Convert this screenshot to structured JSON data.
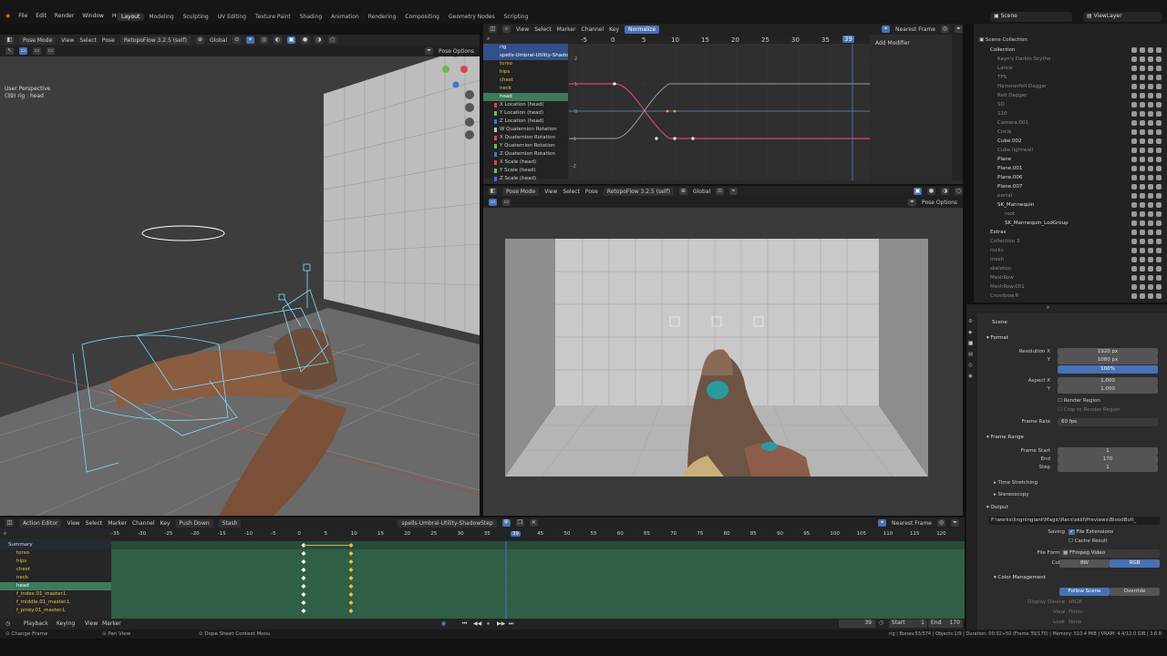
{
  "topbar": {
    "menus": [
      "File",
      "Edit",
      "Render",
      "Window",
      "Help"
    ],
    "workspaces": [
      "Layout",
      "Modeling",
      "Sculpting",
      "UV Editing",
      "Texture Paint",
      "Shading",
      "Animation",
      "Rendering",
      "Compositing",
      "Geometry Nodes",
      "Scripting"
    ],
    "active_workspace": "Layout",
    "scene": "Scene",
    "view_layer": "ViewLayer"
  },
  "viewport": {
    "mode": "Pose Mode",
    "menus": [
      "View",
      "Select",
      "Pose"
    ],
    "action": "RetopoFlow 3.2.5 (self)",
    "orientation": "Global",
    "pose_options": "Pose Options",
    "info_line1": "User Perspective",
    "info_line2": "(39) rig : head"
  },
  "graph": {
    "menus": [
      "View",
      "Select",
      "Marker",
      "Channel",
      "Key"
    ],
    "normalize": "Normalize",
    "snap": "Nearest Frame",
    "add_modifier": "Add Modifier",
    "ticks": [
      "-5",
      "0",
      "5",
      "10",
      "15",
      "20",
      "25",
      "30",
      "35",
      "39"
    ],
    "yticks": [
      "2",
      "1",
      "0",
      "-1",
      "-2"
    ],
    "channels": [
      {
        "label": "rig",
        "cls": "blue"
      },
      {
        "label": "spells-Umbral-Utility-ShadowStep",
        "cls": "blue"
      },
      {
        "label": "torso",
        "cls": "bone"
      },
      {
        "label": "hips",
        "cls": "bone"
      },
      {
        "label": "chest",
        "cls": "bone"
      },
      {
        "label": "neck",
        "cls": "bone"
      },
      {
        "label": "head",
        "cls": "sel"
      },
      {
        "label": "X Location (head)",
        "cls": "",
        "color": "#e04050"
      },
      {
        "label": "Y Location (head)",
        "cls": "",
        "color": "#60c060"
      },
      {
        "label": "Z Location (head)",
        "cls": "",
        "color": "#4070e0"
      },
      {
        "label": "W Quaternion Rotation",
        "cls": "",
        "color": "#c0c0c0"
      },
      {
        "label": "X Quaternion Rotation",
        "cls": "",
        "color": "#e04050"
      },
      {
        "label": "Y Quaternion Rotation",
        "cls": "",
        "color": "#60c060"
      },
      {
        "label": "Z Quaternion Rotation",
        "cls": "",
        "color": "#4070e0"
      },
      {
        "label": "X Scale (head)",
        "cls": "",
        "color": "#e04050"
      },
      {
        "label": "Y Scale (head)",
        "cls": "",
        "color": "#60c060"
      },
      {
        "label": "Z Scale (head)",
        "cls": "",
        "color": "#4070e0"
      }
    ]
  },
  "camview": {
    "mode": "Pose Mode",
    "menus": [
      "View",
      "Select",
      "Pose"
    ],
    "action": "RetopoFlow 3.2.5 (self)",
    "orientation": "Global",
    "pose_options": "Pose Options"
  },
  "outliner": {
    "title": "Scene Collection",
    "items": [
      {
        "label": "Collection",
        "indent": 1,
        "color": "#ddd"
      },
      {
        "label": "Kayn's Darkin Scythe",
        "indent": 2,
        "color": "#888"
      },
      {
        "label": "Lance",
        "indent": 2,
        "color": "#888"
      },
      {
        "label": "TPS",
        "indent": 2,
        "color": "#888"
      },
      {
        "label": "Hammerfell Dagger",
        "indent": 2,
        "color": "#888"
      },
      {
        "label": "Red Dagger",
        "indent": 2,
        "color": "#888"
      },
      {
        "label": "SD",
        "indent": 2,
        "color": "#888"
      },
      {
        "label": "110",
        "indent": 2,
        "color": "#888"
      },
      {
        "label": "Camera.001",
        "indent": 2,
        "color": "#888"
      },
      {
        "label": "Circle",
        "indent": 2,
        "color": "#888"
      },
      {
        "label": "Cube.002",
        "indent": 2,
        "color": "#ddd"
      },
      {
        "label": "Cube.lightwall",
        "indent": 2,
        "color": "#888"
      },
      {
        "label": "Plane",
        "indent": 2,
        "color": "#ddd"
      },
      {
        "label": "Plane.001",
        "indent": 2,
        "color": "#ddd"
      },
      {
        "label": "Plane.006",
        "indent": 2,
        "color": "#ddd"
      },
      {
        "label": "Plane.007",
        "indent": 2,
        "color": "#ddd"
      },
      {
        "label": "portal",
        "indent": 2,
        "color": "#888"
      },
      {
        "label": "SK_Mannequin",
        "indent": 2,
        "color": "#ddd"
      },
      {
        "label": "root",
        "indent": 3,
        "color": "#888"
      },
      {
        "label": "SK_Mannequin_LodGroup",
        "indent": 3,
        "color": "#ddd"
      },
      {
        "label": "Extras",
        "indent": 1,
        "color": "#ddd"
      },
      {
        "label": "Collection 3",
        "indent": 1,
        "color": "#888"
      },
      {
        "label": "rocks",
        "indent": 1,
        "color": "#888"
      },
      {
        "label": "mesh",
        "indent": 1,
        "color": "#888"
      },
      {
        "label": "skeleton",
        "indent": 1,
        "color": "#888"
      },
      {
        "label": "MeshRow",
        "indent": 1,
        "color": "#888"
      },
      {
        "label": "MeshRow.001",
        "indent": 1,
        "color": "#888"
      },
      {
        "label": "Crossbow.R",
        "indent": 1,
        "color": "#888"
      }
    ]
  },
  "properties": {
    "scene": "Scene",
    "format_title": "Format",
    "res_x_label": "Resolution X",
    "res_x": "1920 px",
    "res_y_label": "Y",
    "res_y": "1080 px",
    "res_pct": "100%",
    "aspect_x_label": "Aspect X",
    "aspect_x": "1.000",
    "aspect_y_label": "Y",
    "aspect_y": "1.000",
    "render_region": "Render Region",
    "crop_region": "Crop to Render Region",
    "frame_rate_label": "Frame Rate",
    "frame_rate": "60 fps",
    "frame_range_title": "Frame Range",
    "frame_start_label": "Frame Start",
    "frame_start": "1",
    "end_label": "End",
    "end": "170",
    "step_label": "Step",
    "step": "1",
    "time_stretching": "Time Stretching",
    "stereoscopy": "Stereoscopy",
    "output_title": "Output",
    "output_path": "F:\\works\\lingningiant\\Magic\\Recs\\skill\\Previews\\BloodBolt_",
    "saving_label": "Saving",
    "file_extensions": "File Extensions",
    "cache_result": "Cache Result",
    "file_format_label": "File Format",
    "file_format": "FFmpeg Video",
    "color_label": "Color",
    "color_bw": "BW",
    "color_rgb": "RGB",
    "color_management": "Color Management",
    "follow_scene": "Follow Scene",
    "override": "Override",
    "display_device_label": "Display Device",
    "display_device": "sRGB",
    "view_label": "View",
    "view_value": "Filmic",
    "look_label": "Look",
    "look_value": "None"
  },
  "dopesheet": {
    "editor": "Action Editor",
    "menus": [
      "View",
      "Select",
      "Marker",
      "Channel",
      "Key"
    ],
    "push_down": "Push Down",
    "stash": "Stash",
    "action": "spells-Umbral-Utility-ShadowStep",
    "snap": "Nearest Frame",
    "ticks": [
      "-35",
      "-30",
      "-25",
      "-20",
      "-15",
      "-10",
      "-5",
      "0",
      "5",
      "10",
      "15",
      "20",
      "25",
      "30",
      "35",
      "39",
      "45",
      "50",
      "55",
      "60",
      "65",
      "70",
      "75",
      "80",
      "85",
      "90",
      "95",
      "100",
      "105",
      "110",
      "115",
      "120"
    ],
    "channels": [
      {
        "label": "Summary",
        "cls": "sum"
      },
      {
        "label": "torso",
        "cls": ""
      },
      {
        "label": "hips",
        "cls": ""
      },
      {
        "label": "chest",
        "cls": ""
      },
      {
        "label": "neck",
        "cls": ""
      },
      {
        "label": "head",
        "cls": "hl"
      },
      {
        "label": "f_index.01_master.L",
        "cls": ""
      },
      {
        "label": "f_middle.01_master.L",
        "cls": ""
      },
      {
        "label": "f_pinky.01_master.L",
        "cls": ""
      }
    ]
  },
  "timeline": {
    "menus": [
      "Playback",
      "Keying",
      "View",
      "Marker"
    ],
    "current_frame": "39",
    "start_label": "Start",
    "start": "1",
    "end_label": "End",
    "end": "170"
  },
  "status": {
    "left": "Change Frame",
    "mid1": "Pan View",
    "mid2": "Dope Sheet Context Menu",
    "right": "rig | Bones:53/374 | Objects:1/9 | Duration: 00:02+50 (Frame 39/170) | Memory: 510.4 MiB | VRAM: 4.4/12.0 GiB | 3.6.8"
  }
}
